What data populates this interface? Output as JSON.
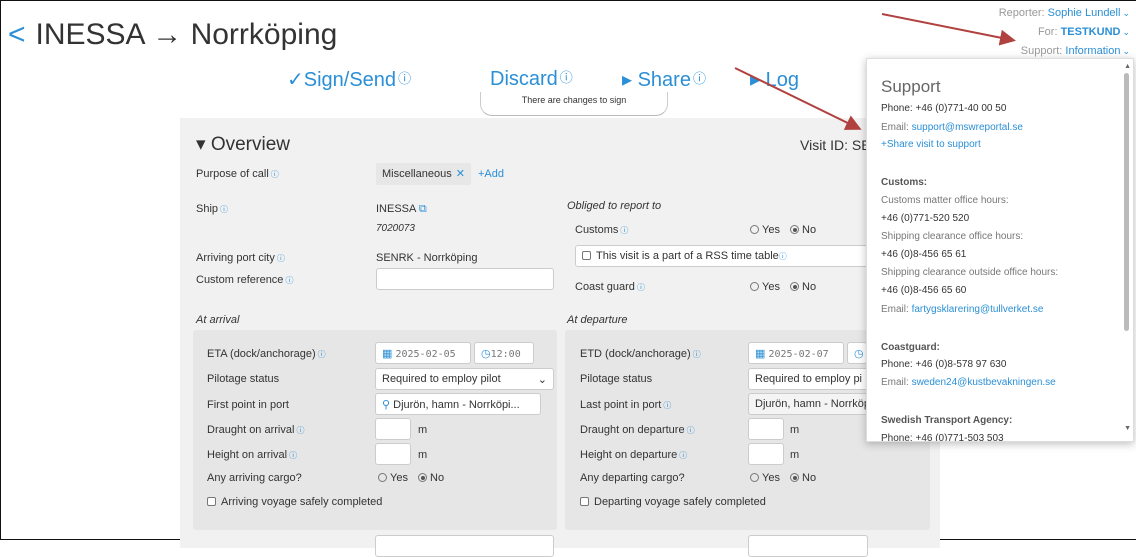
{
  "header": {
    "title": "INESSA → Norrköping",
    "back_glyph": "<",
    "reporter_label": "Reporter:",
    "reporter_value": "Sophie Lundell",
    "for_label": "For:",
    "for_value": "TESTKUND",
    "support_label": "Support:",
    "support_value": "Information"
  },
  "actions": {
    "sign": "✓Sign/Send",
    "discard": "Discard",
    "share": "▸ Share",
    "log": "▸ Log",
    "help_glyph": "ⓘ",
    "notice": "There are changes to sign"
  },
  "overview": {
    "title": "▾ Overview",
    "visit_id": "Visit ID: SE",
    "purpose_label": "Purpose of call",
    "purpose_value": "Miscellaneous",
    "add_label": "+Add",
    "ship_label": "Ship",
    "ship_name": "INESSA",
    "ship_imo": "7020073",
    "arriving_label": "Arriving port city",
    "arriving_value": "SENRK - Norrköping",
    "custom_ref_label": "Custom reference",
    "obliged_label": "Obliged to report to",
    "customs_label": "Customs",
    "rss_label": "This visit is a part of a RSS time table",
    "coast_label": "Coast guard",
    "yes": "Yes",
    "no": "No"
  },
  "arrival": {
    "section": "At arrival",
    "eta_label": "ETA (dock/anchorage)",
    "eta_date": "2025-02-05",
    "eta_time": "12:00",
    "pilotage_label": "Pilotage status",
    "pilotage_value": "Required to employ pilot",
    "first_point_label": "First point in port",
    "first_point_value": "Djurön, hamn - Norrköpi...",
    "draught_label": "Draught on arrival",
    "height_label": "Height on arrival",
    "cargo_label": "Any arriving cargo?",
    "completed_label": "Arriving voyage safely completed",
    "unit": "m"
  },
  "departure": {
    "section": "At departure",
    "etd_label": "ETD (dock/anchorage)",
    "etd_date": "2025-02-07",
    "pilotage_label": "Pilotage status",
    "pilotage_value": "Required to employ pi",
    "last_point_label": "Last point in port",
    "last_point_value": "Djurön, hamn - Norrköp",
    "draught_label": "Draught on departure",
    "height_label": "Height on departure",
    "cargo_label": "Any departing cargo?",
    "completed_label": "Departing voyage safely completed",
    "unit": "m"
  },
  "support": {
    "title": "Support",
    "phone": "Phone: +46 (0)771-40 00 50",
    "email_prefix": "Email:",
    "email": "support@mswreportal.se",
    "share": "+Share visit to support",
    "customs_head": "Customs:",
    "customs_hours_label": "Customs matter office hours:",
    "customs_hours_phone": "+46 (0)771-520 520",
    "clearance_label": "Shipping clearance office hours:",
    "clearance_phone": "+46 (0)8-456 65 61",
    "clearance_out_label": "Shipping clearance outside office hours:",
    "clearance_out_phone": "+46 (0)8-456 65 60",
    "customs_email": "fartygsklarering@tullverket.se",
    "coast_head": "Coastguard:",
    "coast_phone": "Phone: +46 (0)8-578 97 630",
    "coast_email": "sweden24@kustbevakningen.se",
    "sta_head": "Swedish Transport Agency:",
    "sta_phone": "Phone: +46 (0)771-503 503"
  },
  "colors": {
    "accent": "#2a8fd6",
    "card": "#f1f1f1",
    "arrow": "#b0413e"
  }
}
